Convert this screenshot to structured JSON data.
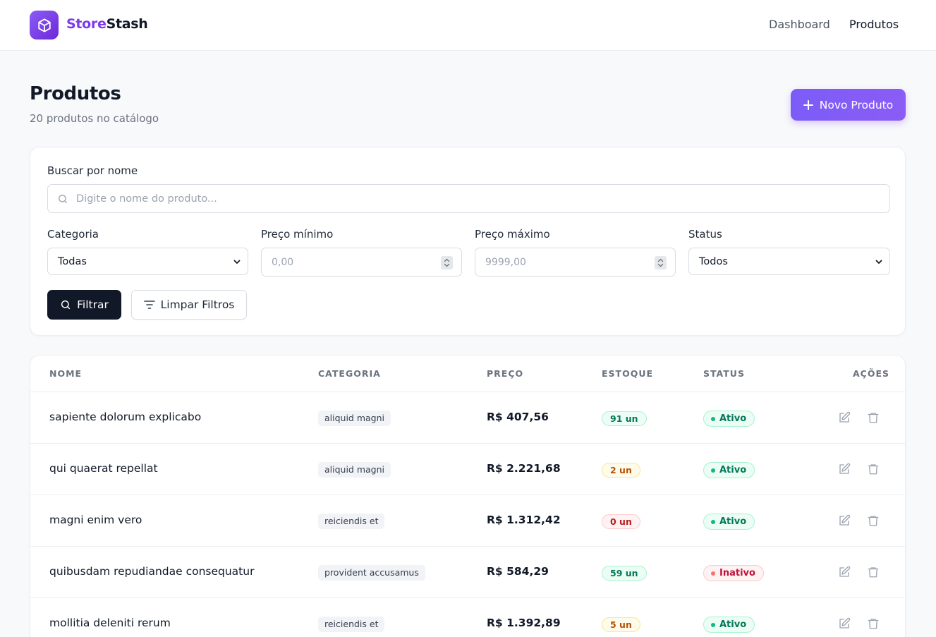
{
  "header": {
    "brand_part1": "Store",
    "brand_part2": "Stash",
    "nav": [
      {
        "label": "Dashboard"
      },
      {
        "label": "Produtos"
      }
    ]
  },
  "page": {
    "title": "Produtos",
    "subtitle": "20 produtos no catálogo",
    "new_button_label": "Novo Produto"
  },
  "filters": {
    "search_label": "Buscar por nome",
    "search_placeholder": "Digite o nome do produto...",
    "search_value": "",
    "category_label": "Categoria",
    "category_value": "Todas",
    "min_price_label": "Preço mínimo",
    "min_price_placeholder": "0,00",
    "max_price_label": "Preço máximo",
    "max_price_placeholder": "9999,00",
    "status_label": "Status",
    "status_value": "Todos",
    "filter_button": "Filtrar",
    "clear_button": "Limpar Filtros"
  },
  "table": {
    "columns": [
      "Nome",
      "Categoria",
      "Preço",
      "Estoque",
      "Status",
      "Ações"
    ],
    "rows": [
      {
        "name": "sapiente dolorum explicabo",
        "category": "aliquid magni",
        "price": "R$ 407,56",
        "stock": "91 un",
        "status": "Ativo"
      },
      {
        "name": "qui quaerat repellat",
        "category": "aliquid magni",
        "price": "R$ 2.221,68",
        "stock": "2 un",
        "status": "Ativo"
      },
      {
        "name": "magni enim vero",
        "category": "reiciendis et",
        "price": "R$ 1.312,42",
        "stock": "0 un",
        "status": "Ativo"
      },
      {
        "name": "quibusdam repudiandae consequatur",
        "category": "provident accusamus",
        "price": "R$ 584,29",
        "stock": "59 un",
        "status": "Inativo"
      },
      {
        "name": "mollitia deleniti rerum",
        "category": "reiciendis et",
        "price": "R$ 1.392,89",
        "stock": "5 un",
        "status": "Ativo"
      }
    ]
  },
  "colors": {
    "brand": "#7c3aed",
    "primary_button": "#8b5cf6",
    "dark_button": "#111827",
    "active_green": "#047857",
    "inactive_red": "#be123c",
    "low_stock_amber": "#b45309"
  },
  "icons": {
    "logo": "cube-icon",
    "new": "plus-icon",
    "search": "search-icon",
    "filter": "filter-lines-icon",
    "select": "chevron-down-icon",
    "edit": "edit-icon",
    "delete": "trash-icon"
  }
}
